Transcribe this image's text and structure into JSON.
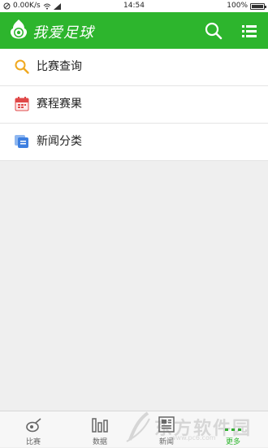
{
  "status_bar": {
    "net_speed": "0.00K/s",
    "time": "14:54",
    "battery": "100%"
  },
  "app_bar": {
    "title": "我爱足球",
    "search_icon": "search-icon",
    "menu_icon": "list-menu-icon",
    "accent_color": "#2db52d"
  },
  "menu": {
    "items": [
      {
        "label": "比赛查询",
        "icon": "search-icon"
      },
      {
        "label": "赛程赛果",
        "icon": "calendar-icon"
      },
      {
        "label": "新闻分类",
        "icon": "news-category-icon"
      }
    ]
  },
  "bottom_nav": {
    "tabs": [
      {
        "label": "比赛",
        "icon": "whistle-icon"
      },
      {
        "label": "数据",
        "icon": "bar-chart-icon"
      },
      {
        "label": "新闻",
        "icon": "newspaper-icon"
      },
      {
        "label": "更多",
        "icon": "more-dots-icon"
      }
    ],
    "active": "更多"
  },
  "watermark": {
    "text": "东方软件园",
    "url": "www.pc6.com"
  }
}
